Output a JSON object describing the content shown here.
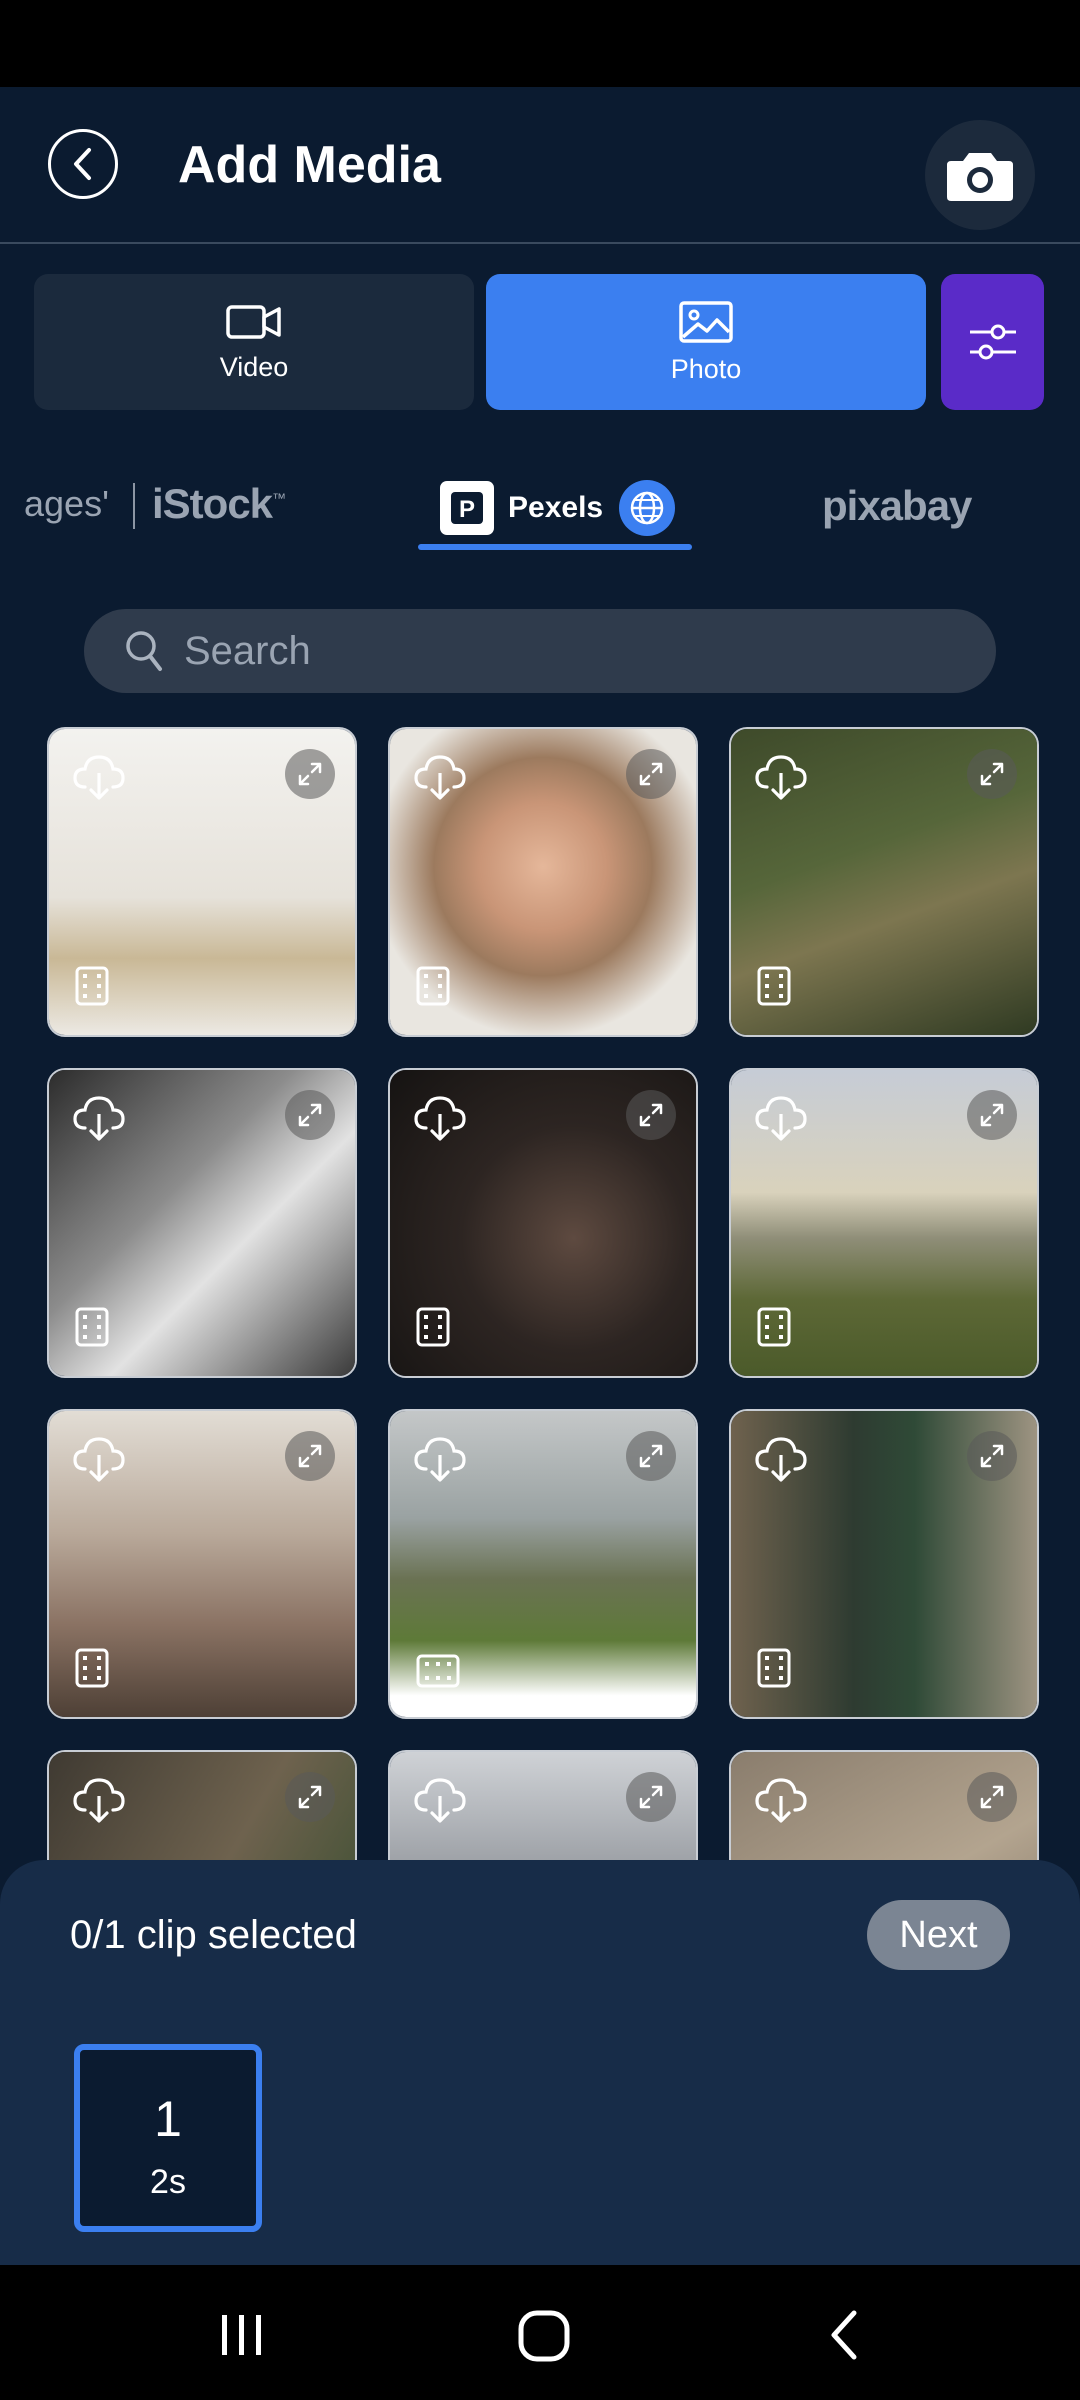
{
  "header": {
    "title": "Add Media",
    "back_icon": "chevron-left-icon",
    "camera_icon": "camera-icon"
  },
  "media_tabs": [
    {
      "label": "Video",
      "icon": "video-camera-icon",
      "selected": false
    },
    {
      "label": "Photo",
      "icon": "image-icon",
      "selected": true
    }
  ],
  "filter_icon": "sliders-icon",
  "providers": {
    "images_partial": "ages'",
    "istock": "iStock",
    "istock_mark": "™",
    "pexels_logo_letter": "P",
    "pexels": "Pexels",
    "pixabay": "pixabay",
    "selected": "Pexels"
  },
  "search": {
    "placeholder": "Search"
  },
  "photos": [
    {
      "subject": "dried pampas vase on glass table",
      "orientation": "portrait"
    },
    {
      "subject": "woman with orange eye makeup",
      "orientation": "portrait"
    },
    {
      "subject": "aerial tower on green hillside",
      "orientation": "portrait"
    },
    {
      "subject": "man lifting dumbbells black and white",
      "orientation": "portrait"
    },
    {
      "subject": "person lying on dark stairs",
      "orientation": "portrait"
    },
    {
      "subject": "mountains over green field at dusk",
      "orientation": "portrait"
    },
    {
      "subject": "city street with hanging flags",
      "orientation": "portrait"
    },
    {
      "subject": "field with ruined building and cloudy sky",
      "orientation": "landscape"
    },
    {
      "subject": "young man in green sweater",
      "orientation": "portrait"
    },
    {
      "subject": "rock cliff with tree",
      "orientation": "portrait"
    },
    {
      "subject": "snowy mountains under clouds",
      "orientation": "portrait"
    },
    {
      "subject": "rocky terrain",
      "orientation": "portrait"
    }
  ],
  "selection": {
    "count_text": "0/1 clip selected",
    "next_label": "Next",
    "clip_number": "1",
    "clip_duration": "2s"
  },
  "colors": {
    "background": "#0b1b30",
    "accent": "#3b7ff0",
    "filter": "#5a2bc8",
    "sheet": "#172c48"
  }
}
